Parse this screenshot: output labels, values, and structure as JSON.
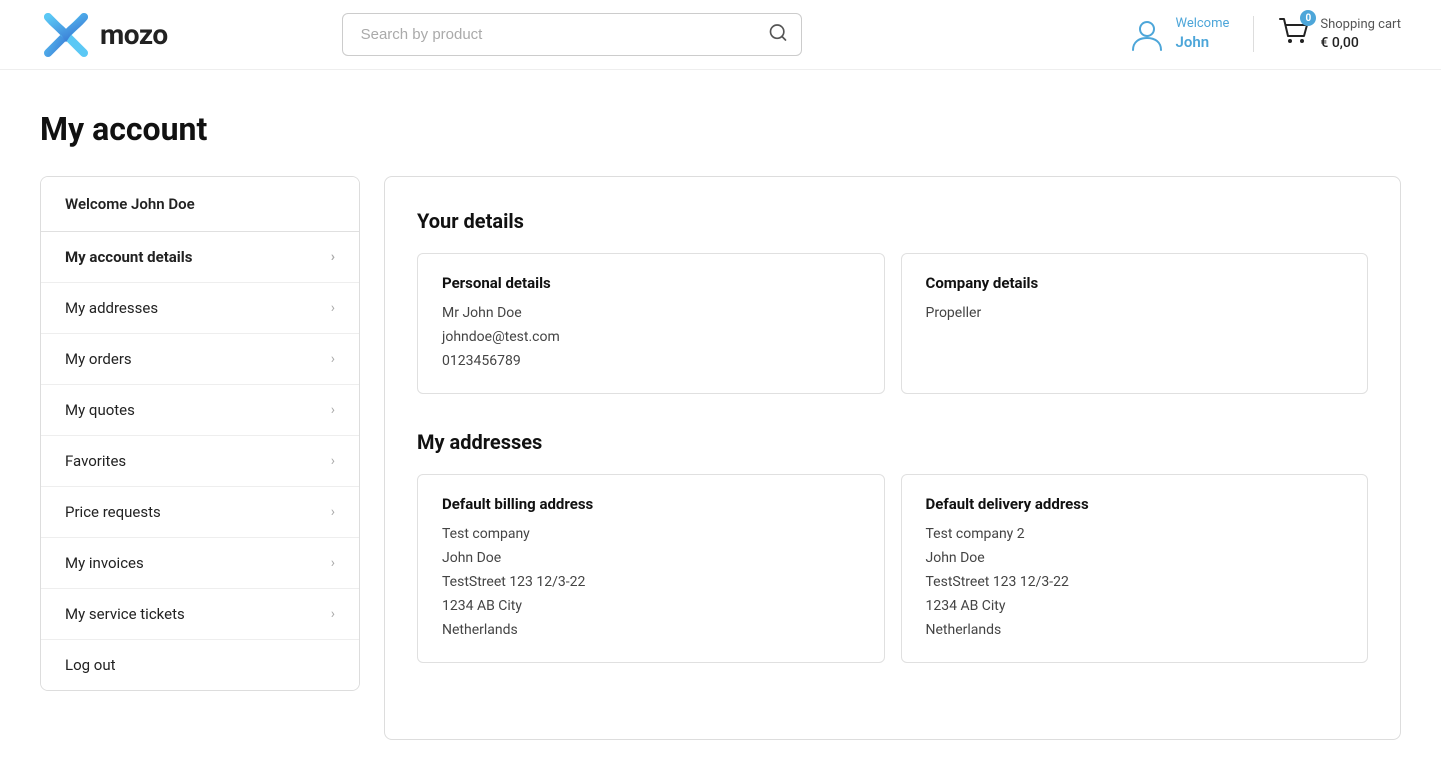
{
  "header": {
    "logo_text": "mozo",
    "search_placeholder": "Search by product",
    "user_welcome": "Welcome",
    "user_name": "John",
    "cart_label": "Shopping cart",
    "cart_price": "€ 0,00",
    "cart_badge": "0"
  },
  "page": {
    "title": "My account"
  },
  "sidebar": {
    "greeting": "Welcome John Doe",
    "items": [
      {
        "label": "My account details",
        "active": true
      },
      {
        "label": "My addresses",
        "active": false
      },
      {
        "label": "My orders",
        "active": false
      },
      {
        "label": "My quotes",
        "active": false
      },
      {
        "label": "Favorites",
        "active": false
      },
      {
        "label": "Price requests",
        "active": false
      },
      {
        "label": "My invoices",
        "active": false
      },
      {
        "label": "My service tickets",
        "active": false
      },
      {
        "label": "Log out",
        "active": false
      }
    ]
  },
  "details": {
    "section1_title": "Your details",
    "personal_card": {
      "title": "Personal details",
      "line1": "Mr John Doe",
      "line2": "johndoe@test.com",
      "line3": "0123456789"
    },
    "company_card": {
      "title": "Company details",
      "line1": "Propeller"
    },
    "section2_title": "My addresses",
    "billing_card": {
      "title": "Default billing address",
      "line1": "Test company",
      "line2": "John Doe",
      "line3": "TestStreet 123 12/3-22",
      "line4": "1234 AB City",
      "line5": "Netherlands"
    },
    "delivery_card": {
      "title": "Default delivery address",
      "line1": "Test company 2",
      "line2": "John Doe",
      "line3": "TestStreet 123 12/3-22",
      "line4": "1234 AB City",
      "line5": "Netherlands"
    }
  }
}
